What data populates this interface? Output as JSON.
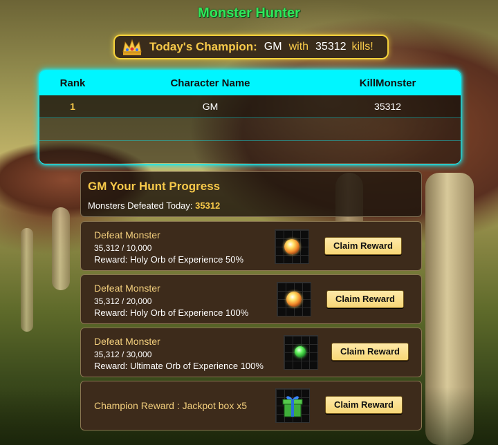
{
  "title": "Monster Hunter",
  "champion": {
    "label": "Today's Champion:",
    "name": "GM",
    "with_text": "with",
    "kills": "35312",
    "kills_text": "kills!"
  },
  "ranking": {
    "headers": [
      "Rank",
      "Character Name",
      "KillMonster"
    ],
    "rows": [
      {
        "rank": "1",
        "name": "GM",
        "kills": "35312"
      },
      {
        "rank": "",
        "name": "",
        "kills": ""
      },
      {
        "rank": "",
        "name": "",
        "kills": ""
      }
    ]
  },
  "progress": {
    "heading": "GM Your Hunt Progress",
    "defeated_label": "Monsters Defeated Today:",
    "defeated_value": "35312"
  },
  "rewards": [
    {
      "title": "Defeat Monster",
      "count": "35,312 / 10,000",
      "reward": "Reward: Holy Orb of Experience 50%",
      "icon": "holy-orb-icon",
      "button": "Claim Reward"
    },
    {
      "title": "Defeat Monster",
      "count": "35,312 / 20,000",
      "reward": "Reward: Holy Orb of Experience 100%",
      "icon": "holy-orb-icon",
      "button": "Claim Reward"
    },
    {
      "title": "Defeat Monster",
      "count": "35,312 / 30,000",
      "reward": "Reward: Ultimate Orb of Experience 100%",
      "icon": "ultimate-orb-icon",
      "button": "Claim Reward"
    },
    {
      "title": "Champion Reward : Jackpot box x5",
      "icon": "gift-box-icon",
      "button": "Claim Reward"
    }
  ],
  "colors": {
    "title": "#2ee85a",
    "gold": "#f7c94a",
    "table_header": "#00f6ff",
    "card_bg": "#3d2b1b",
    "button": "#f7d777"
  }
}
